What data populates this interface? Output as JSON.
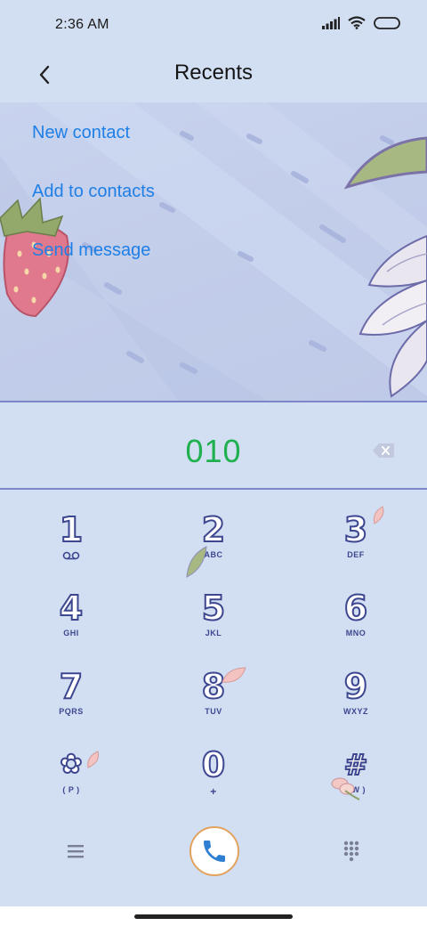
{
  "status_bar": {
    "time": "2:36 AM"
  },
  "header": {
    "title": "Recents"
  },
  "menu": {
    "new_contact": "New contact",
    "add_to_contacts": "Add to contacts",
    "send_message": "Send message"
  },
  "dialer": {
    "number": "010"
  },
  "keypad": [
    {
      "digit": "1",
      "letters": ""
    },
    {
      "digit": "2",
      "letters": "ABC"
    },
    {
      "digit": "3",
      "letters": "DEF"
    },
    {
      "digit": "4",
      "letters": "GHI"
    },
    {
      "digit": "5",
      "letters": "JKL"
    },
    {
      "digit": "6",
      "letters": "MNO"
    },
    {
      "digit": "7",
      "letters": "PQRS"
    },
    {
      "digit": "8",
      "letters": "TUV"
    },
    {
      "digit": "9",
      "letters": "WXYZ"
    },
    {
      "digit": "✿",
      "letters": "( P )"
    },
    {
      "digit": "0",
      "letters": "+"
    },
    {
      "digit": "#",
      "letters": "( W )"
    }
  ],
  "colors": {
    "link": "#1e7fe6",
    "number": "#1fb04f",
    "key_outline": "#3d4790",
    "call_icon": "#2f7fd3",
    "call_ring": "#e2a35f"
  },
  "icons": {
    "back": "back-arrow-icon",
    "backspace": "backspace-icon",
    "voicemail": "voicemail-icon",
    "menu": "hamburger-menu-icon",
    "call": "phone-call-icon",
    "dialpad": "dialpad-grid-icon"
  }
}
